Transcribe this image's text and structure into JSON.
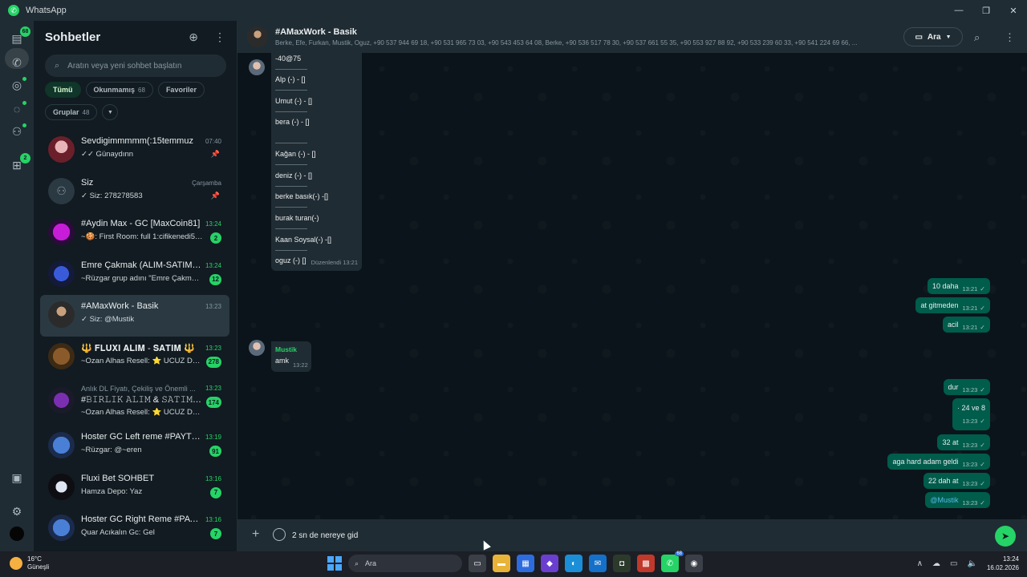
{
  "window": {
    "title": "WhatsApp"
  },
  "rail": {
    "chats_badge": "68",
    "updates_badge": "2"
  },
  "sidebar": {
    "title": "Sohbetler",
    "search_placeholder": "Aratın veya yeni sohbet başlatın",
    "filters": [
      {
        "label": "Tümü",
        "count": ""
      },
      {
        "label": "Okunmamış",
        "count": "68"
      },
      {
        "label": "Favoriler",
        "count": ""
      },
      {
        "label": "Gruplar",
        "count": "48"
      }
    ],
    "chats": [
      {
        "name": "Sevdigimmmmm(:15temmuz",
        "time": "07:40",
        "preview": "✓✓ Günaydınn",
        "unread": "",
        "pinned": true
      },
      {
        "name": "Siz",
        "time": "Çarşamba",
        "preview": "✓ Siz: 278278583",
        "unread": "",
        "pinned": true
      },
      {
        "name": "#Aydin Max - GC [MaxCoin81]",
        "time": "13:24",
        "preview": "~🍪: First Room: full 1:cifikenedi5-...",
        "unread": "2"
      },
      {
        "name": "Emre Çakmak (ALIM-SATIM) ...",
        "time": "13:24",
        "preview": "~Rüzgar grup adını \"Emre Çakmak...",
        "unread": "12"
      },
      {
        "name": "#AMaxWork - Basik",
        "time": "13:23",
        "preview": "✓ Siz: @Mustik",
        "unread": ""
      },
      {
        "name": "🔱 𝐅𝐋𝐔𝐗𝐈 𝐀𝐋𝐈𝐌 - 𝐒𝐀𝐓𝐈𝐌 🔱",
        "time": "13:23",
        "preview": "~Ozan Alhas Resell: ⭐ UCUZ DL ...",
        "unread": "278"
      },
      {
        "name": "#𝙱𝙸𝚁𝙻𝙸𝙺 𝙰𝙻𝙸𝙼 & 𝚂𝙰𝚃𝙸𝙼 #3 ...",
        "community": "Anlık DL Fiyatı, Çekiliş ve Önemli ...",
        "time": "13:23",
        "preview": "~Ozan Alhas Resell: ⭐ UCUZ DL / BGL...",
        "unread": "174"
      },
      {
        "name": "Hoster GC Left reme #PAYTO...",
        "time": "13:19",
        "preview": "~Rüzgar: @~eren",
        "unread": "91"
      },
      {
        "name": "Fluxi Bet SOHBET",
        "time": "13:16",
        "preview": "Hamza Depo: Yaz",
        "unread": "7"
      },
      {
        "name": "Hoster GC Right Reme #PAY...",
        "time": "13:16",
        "preview": "Quar Acıkalın Gc: Gel",
        "unread": "7"
      }
    ]
  },
  "header": {
    "title": "#AMaxWork - Basik",
    "members": "Berke, Efe, Furkan, Mustik, Oguz, +90 537 944 69 18, +90 531 965 73 03, +90 543 453 64 08, Berke, +90 536 517 78 30, +90 537 661 55 35, +90 553 927 88 92, +90 533 239 60 33, +90 541 224 69 66, ...",
    "call_label": "Ara"
  },
  "long_message": {
    "lines": [
      "-40@75",
      "Alp (-) - []",
      "Umut (-) - []",
      "bera (-) - []",
      "Kağan (-) - []",
      "deniz (-) - []",
      "berke basık(-) -[]",
      "burak turan(-)",
      "Kaan Soysal(-) -[]",
      "oguz (-) []"
    ],
    "edited": "Düzenlendi 13:21"
  },
  "outgoing_group1": [
    {
      "text": "10 daha",
      "time": "13:21"
    },
    {
      "text": "at gitmeden",
      "time": "13:21"
    },
    {
      "text": "acil",
      "time": "13:21"
    }
  ],
  "incoming": {
    "sender": "Mustik",
    "text": "amk",
    "time": "13:22"
  },
  "outgoing_group2": [
    {
      "text": "dur",
      "time": "13:23"
    },
    {
      "text": "· 24 ve 8",
      "time": "13:23"
    },
    {
      "text": "32 at",
      "time": "13:23"
    },
    {
      "text": "aga hard adam geldi",
      "time": "13:23"
    },
    {
      "text": "22 dah at",
      "time": "13:23"
    },
    {
      "text": "@Mustik",
      "time": "13:23"
    }
  ],
  "composer": {
    "value": "2 sn de nereye gid"
  },
  "taskbar": {
    "temperature": "16°C",
    "weather": "Güneşli",
    "search_label": "Ara",
    "time": "13:24",
    "date": "16.02.2026",
    "whatsapp_badge": "68"
  }
}
